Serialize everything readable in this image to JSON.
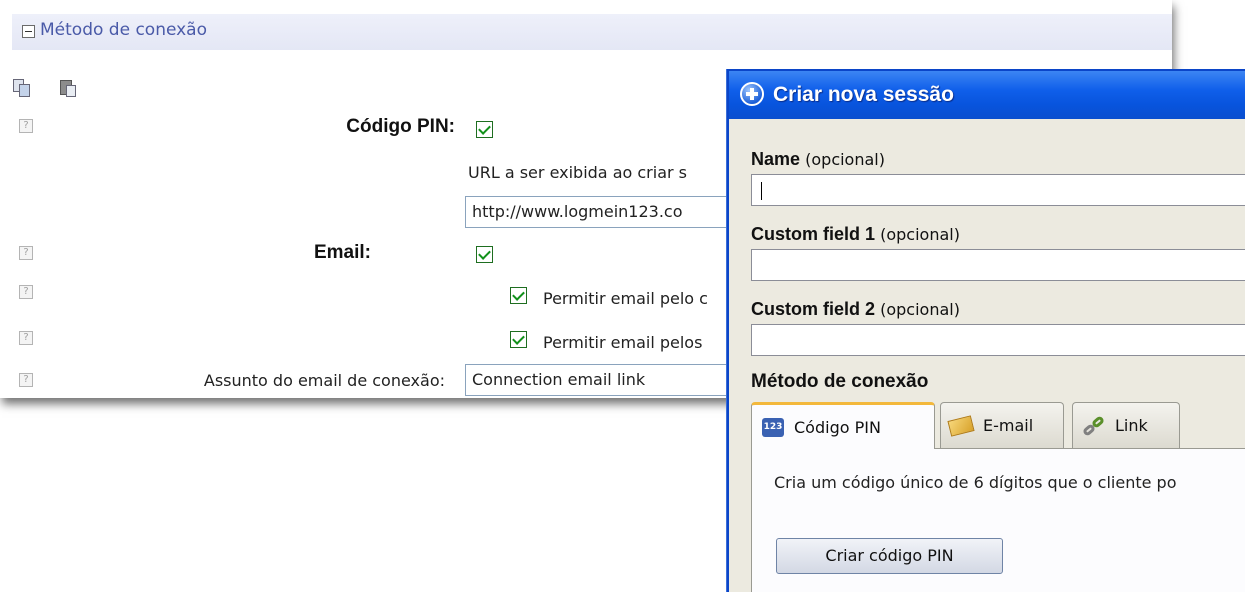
{
  "settings": {
    "section_title": "Método de conexão",
    "icons": {
      "copy": "copy-icon",
      "paste": "paste-icon",
      "help": "help-icon"
    },
    "pin_code_label": "Código PIN:",
    "pin_url_caption": "URL a ser exibida ao criar s",
    "pin_url_value": "http://www.logmein123.co",
    "email_label": "Email:",
    "allow_email_1": "Permitir email pelo c",
    "allow_email_2": "Permitir email pelos",
    "email_subject_label": "Assunto do email de conexão:",
    "email_subject_value": "Connection email link"
  },
  "dialog": {
    "title": "Criar nova sessão",
    "name_label": "Name",
    "name_optional": "(opcional)",
    "custom1_label": "Custom field 1",
    "custom1_optional": "(opcional)",
    "custom2_label": "Custom field 2",
    "custom2_optional": "(opcional)",
    "method_heading": "Método de conexão",
    "tabs": [
      {
        "label": "Código PIN",
        "icon": "pin-code-icon",
        "active": true
      },
      {
        "label": "E-mail",
        "icon": "email-icon",
        "active": false
      },
      {
        "label": "Link",
        "icon": "link-icon",
        "active": false
      }
    ],
    "tab_description": "Cria um código único de 6 dígitos que o cliente po",
    "create_pin_button": "Criar código PIN"
  },
  "colors": {
    "title_bar": "#0854dd",
    "section_header": "#e8ebf7",
    "section_title_text": "#4a5aa8",
    "checkbox_check": "#11911a",
    "active_tab_accent": "#f3b83b"
  }
}
